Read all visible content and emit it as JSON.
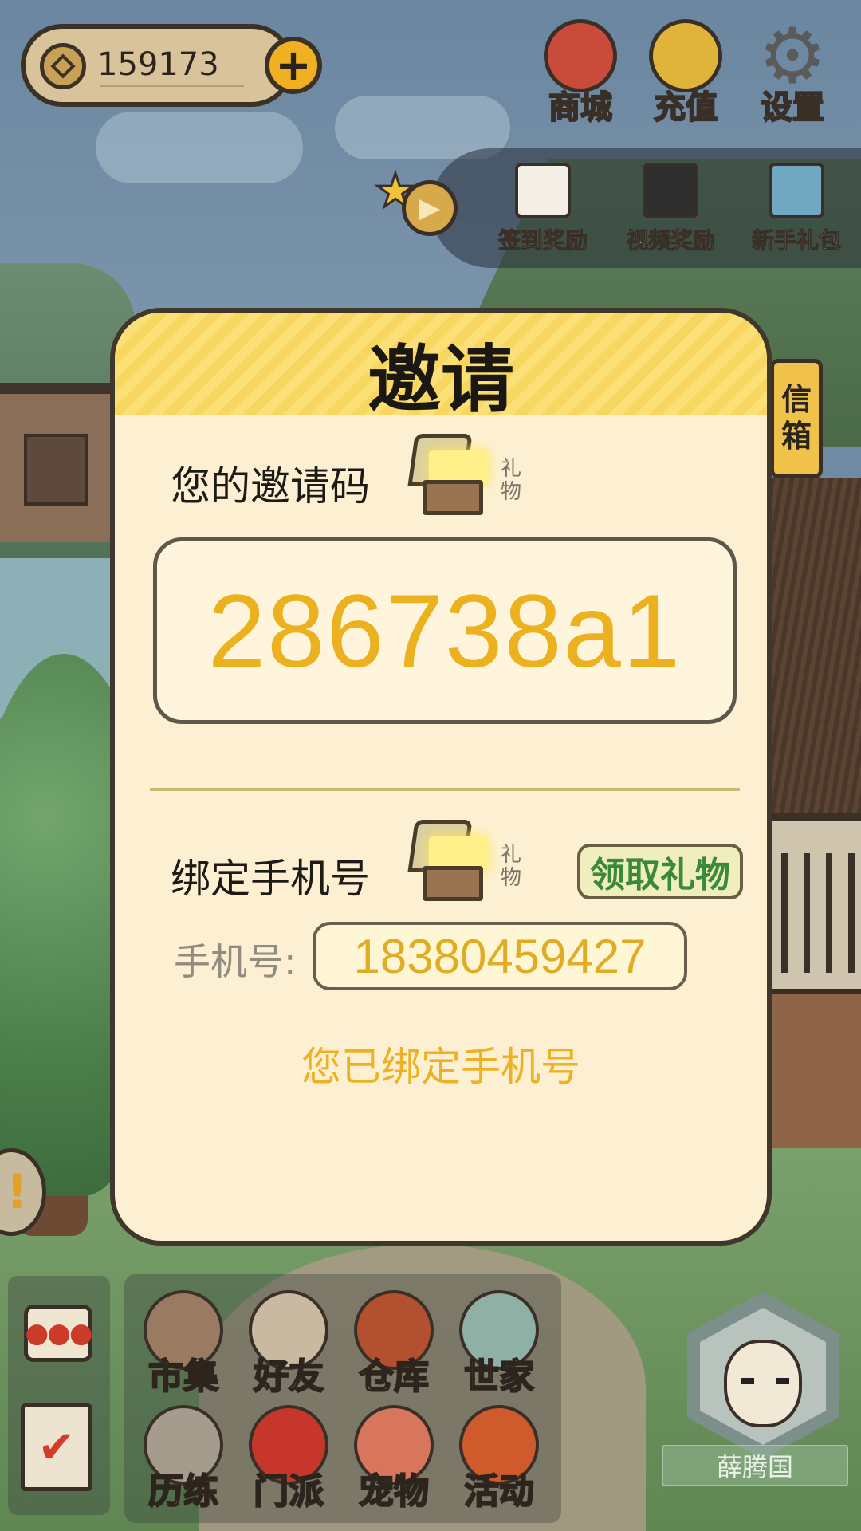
{
  "currency": {
    "coins": "159173"
  },
  "top_menu": [
    {
      "label": "商城",
      "icon": "shop-bag-icon",
      "color": "#c94b3a"
    },
    {
      "label": "充值",
      "icon": "gold-ingot-icon",
      "color": "#e0b43a"
    },
    {
      "label": "设置",
      "icon": "gear-icon",
      "color": "#5a5a5a"
    }
  ],
  "rewards": [
    {
      "label": "签到奖励",
      "icon": "calendar-icon"
    },
    {
      "label": "视频奖励",
      "icon": "clapperboard-icon"
    },
    {
      "label": "新手礼包",
      "icon": "treasure-chest-icon"
    }
  ],
  "mailbox": {
    "line1": "信",
    "line2": "箱"
  },
  "invite_modal": {
    "title": "邀请",
    "code_label": "您的邀请码",
    "gift_text_1": "礼",
    "gift_text_2": "物",
    "invite_code": "286738a1",
    "bind_label": "绑定手机号",
    "claim_button": "领取礼物",
    "phone_label": "手机号:",
    "phone_number": "18380459427",
    "bound_message": "您已绑定手机号"
  },
  "bottom_nav": [
    {
      "label": "市集",
      "icon": "market-icon",
      "color": "#9a7b62"
    },
    {
      "label": "好友",
      "icon": "handshake-icon",
      "color": "#c9b9a0"
    },
    {
      "label": "仓库",
      "icon": "storage-chest-icon",
      "color": "#b3502f"
    },
    {
      "label": "世家",
      "icon": "bronze-vessel-icon",
      "color": "#8fb0a5"
    },
    {
      "label": "历练",
      "icon": "crossed-swords-icon",
      "color": "#a59c8e"
    },
    {
      "label": "门派",
      "icon": "banner-icon",
      "color": "#c7362a"
    },
    {
      "label": "宠物",
      "icon": "paw-icon",
      "color": "#d7755d"
    },
    {
      "label": "活动",
      "icon": "lantern-icon",
      "color": "#cf5a2c"
    }
  ],
  "player": {
    "name": "薛腾国"
  },
  "colors": {
    "accent_gold": "#ebb11f",
    "modal_bg": "#fdf0d2",
    "claim_green": "#3a8a3a"
  }
}
